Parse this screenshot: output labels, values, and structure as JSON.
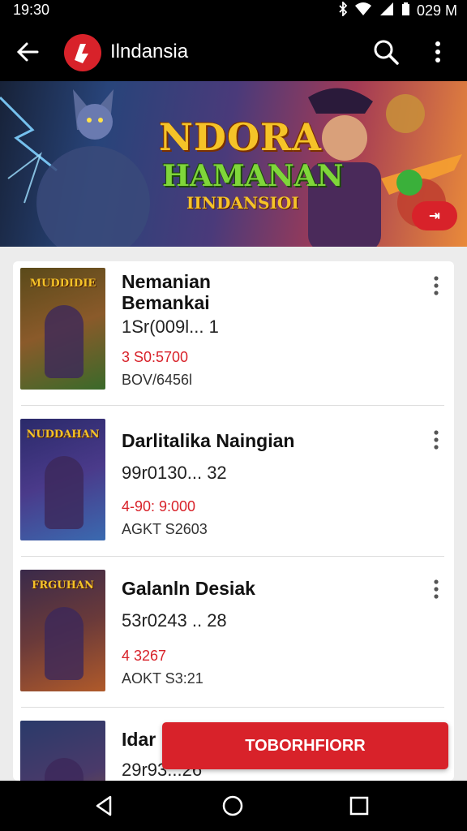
{
  "status_bar": {
    "time": "19:30",
    "right_text": "029 M"
  },
  "app_bar": {
    "title": "Ilndansia"
  },
  "banner": {
    "title_line1": "NDORA",
    "title_line2": "HAMANAN",
    "title_line3": "IINDANSIOI",
    "badge": "⇥"
  },
  "items": [
    {
      "name": "Nemanian Bemankai",
      "meta": "1Sr(009l... 1",
      "price": "3 S0:5700",
      "code": "BOV/6456l",
      "thumb_title": "MUDDIDIE",
      "thumb_colors": [
        "#5a4a1a",
        "#8a5a2a",
        "#3a6a2a"
      ]
    },
    {
      "name": "Darlitalika Naingian",
      "meta": "99r0130... 32",
      "price": "4-90: 9:000",
      "code": "AGKT S2603",
      "thumb_title": "NUDDAHAN",
      "thumb_colors": [
        "#2a2a6a",
        "#4a3a8a",
        "#3a6ab0"
      ]
    },
    {
      "name": "Galanln Desiak",
      "meta": "53r0243 .. 28",
      "price": "4 3267",
      "code": "AOKT S3:21",
      "thumb_title": "FRGUHAN",
      "thumb_colors": [
        "#3a2a4a",
        "#6a3a3a",
        "#b05a2a"
      ]
    },
    {
      "name": "Idar",
      "meta": "29r93...26",
      "price": "",
      "code": "",
      "thumb_title": "",
      "thumb_colors": [
        "#2a3a6a",
        "#4a3a6a",
        "#8a5a2a"
      ]
    }
  ],
  "cta": {
    "label": "TOBORHFIORR"
  }
}
